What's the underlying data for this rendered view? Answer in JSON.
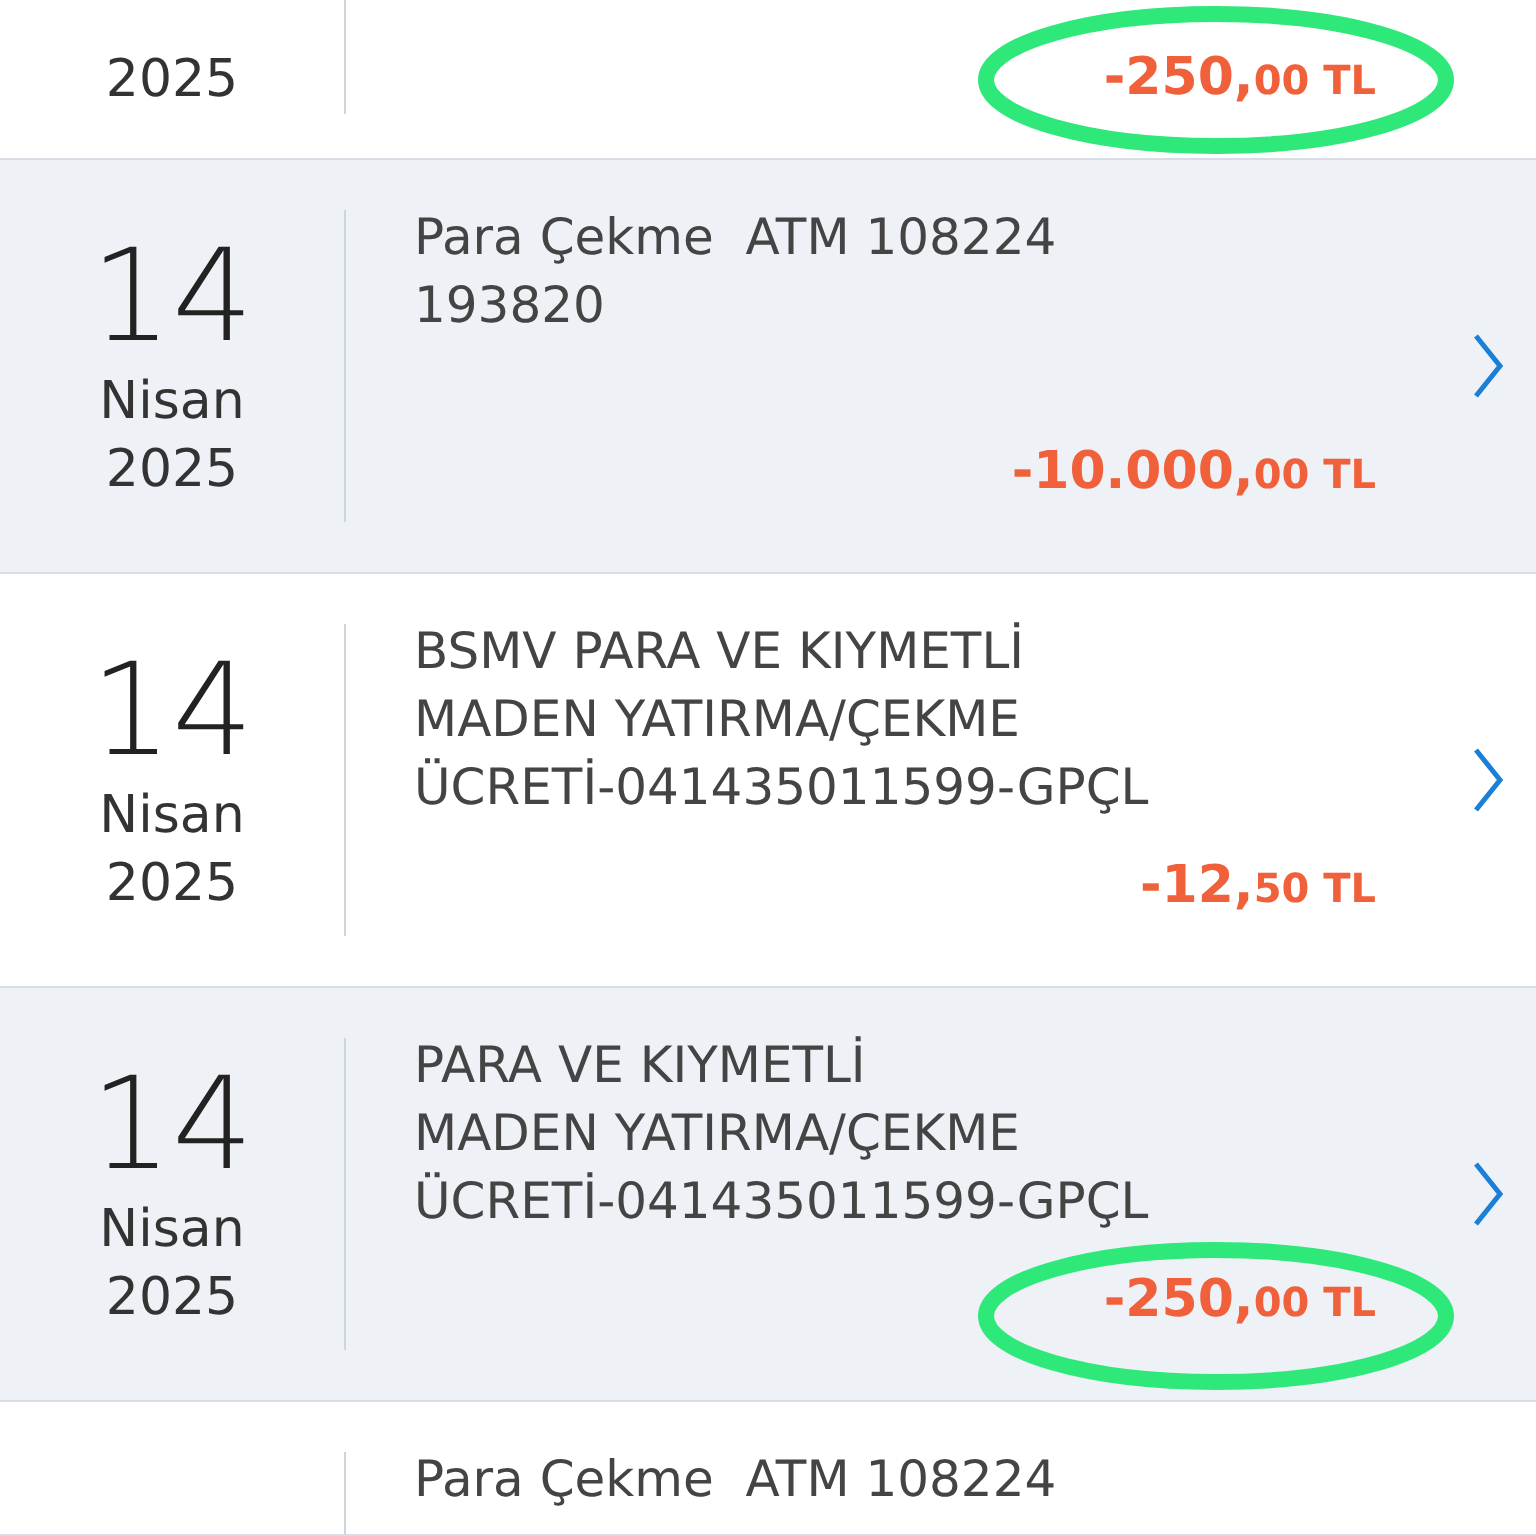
{
  "transactions": [
    {
      "year": "2025",
      "amount": "-250,",
      "fraction": "00 TL",
      "shaded": false,
      "circled": true,
      "chevron": false
    },
    {
      "day": "14",
      "month": "Nisan",
      "year": "2025",
      "description": [
        "Para Çekme  ATM 108224",
        "193820"
      ],
      "amount": "-10.000,",
      "fraction": "00 TL",
      "shaded": true,
      "circled": false,
      "chevron": true
    },
    {
      "day": "14",
      "month": "Nisan",
      "year": "2025",
      "description": [
        "BSMV PARA VE KIYMETLİ",
        "MADEN YATIRMA/ÇEKME",
        "ÜCRETİ-041435011599-GPÇL"
      ],
      "amount": "-12,",
      "fraction": "50 TL",
      "shaded": false,
      "circled": false,
      "chevron": true
    },
    {
      "day": "14",
      "month": "Nisan",
      "year": "2025",
      "description": [
        "PARA VE KIYMETLİ",
        "MADEN YATIRMA/ÇEKME",
        "ÜCRETİ-041435011599-GPÇL"
      ],
      "amount": "-250,",
      "fraction": "00 TL",
      "shaded": true,
      "circled": true,
      "chevron": true
    },
    {
      "description": [
        "Para Çekme  ATM 108224"
      ],
      "shaded": false,
      "circled": false,
      "chevron": false
    }
  ]
}
